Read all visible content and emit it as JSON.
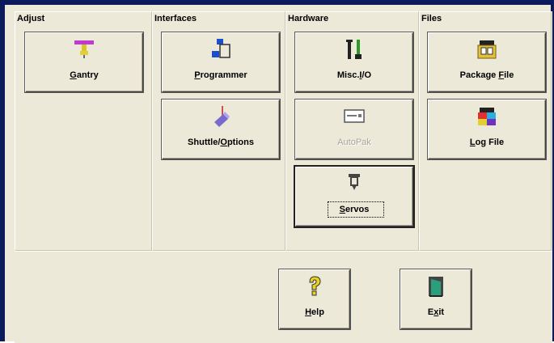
{
  "groups": {
    "adjust": {
      "title": "Adjust"
    },
    "interfaces": {
      "title": "Interfaces"
    },
    "hardware": {
      "title": "Hardware"
    },
    "files": {
      "title": "Files"
    }
  },
  "buttons": {
    "gantry": {
      "pre": "",
      "key": "G",
      "post": "antry",
      "icon": "gantry-icon"
    },
    "programmer": {
      "pre": "",
      "key": "P",
      "post": "rogrammer",
      "icon": "programmer-icon"
    },
    "shuttle": {
      "pre": "Shuttle/",
      "key": "O",
      "post": "ptions",
      "icon": "shuttle-icon"
    },
    "misc_io": {
      "pre": "Misc.",
      "key": "I",
      "post": "/O",
      "icon": "io-icon"
    },
    "autopak": {
      "label": "AutoPak",
      "icon": "autopak-icon",
      "disabled": true
    },
    "servos": {
      "pre": "",
      "key": "S",
      "post": "ervos",
      "icon": "servo-icon"
    },
    "package_file": {
      "pre": "Package ",
      "key": "F",
      "post": "ile",
      "icon": "package-file-icon"
    },
    "log_file": {
      "pre": "",
      "key": "L",
      "post": "og File",
      "icon": "log-file-icon"
    },
    "help": {
      "pre": "",
      "key": "H",
      "post": "elp",
      "icon": "help-icon"
    },
    "exit": {
      "pre": "E",
      "key": "x",
      "post": "it",
      "icon": "exit-icon"
    }
  },
  "colors": {
    "face": "#ece9d8",
    "frame": "#0a1a5a",
    "disabled_text": "#a8a49a"
  }
}
